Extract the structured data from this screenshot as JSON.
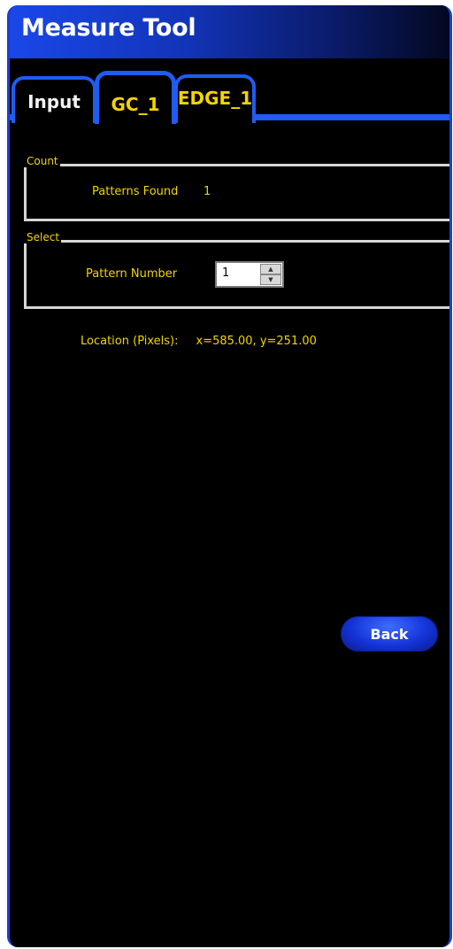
{
  "window": {
    "title": "Measure Tool"
  },
  "tabs": [
    {
      "label": "Input",
      "active": false
    },
    {
      "label": "GC_1",
      "active": true
    },
    {
      "label": "EDGE_1",
      "active": false
    }
  ],
  "count_group": {
    "legend": "Count",
    "patterns_found_label": "Patterns Found",
    "patterns_found_value": "1"
  },
  "select_group": {
    "legend": "Select",
    "pattern_number_label": "Pattern Number",
    "pattern_number_value": "1"
  },
  "location": {
    "label": "Location (Pixels):",
    "value": "x=585.00, y=251.00"
  },
  "actions": {
    "back_label": "Back"
  },
  "colors": {
    "text_accent": "#f2d400",
    "tab_border": "#1f5cf0",
    "title_bar": "#1a47e8",
    "button": "#1434d8"
  },
  "icons": {
    "spin_up": "triangle-up",
    "spin_down": "triangle-down"
  }
}
